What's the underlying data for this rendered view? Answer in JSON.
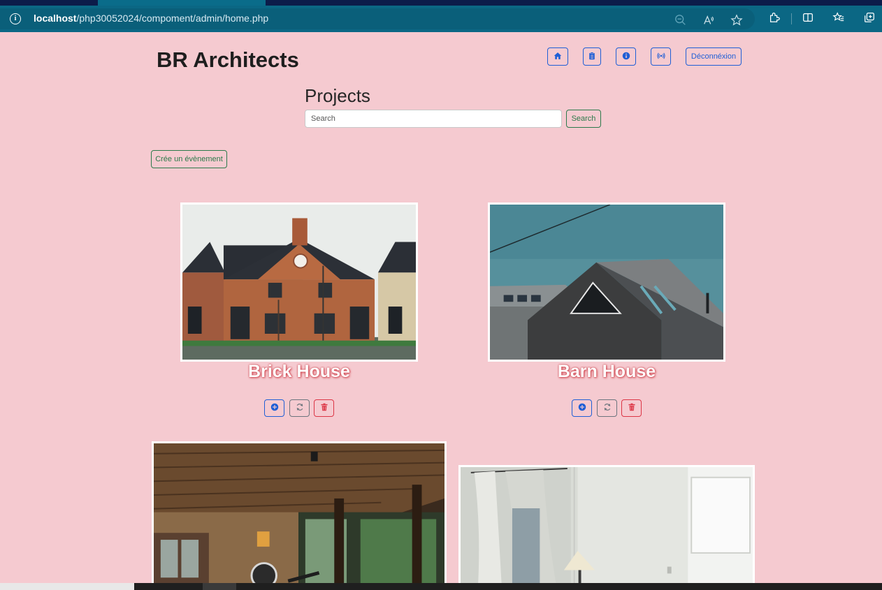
{
  "browser": {
    "url_host": "localhost",
    "url_path": "/php30052024/compoment/admin/home.php",
    "icons": [
      "info-icon",
      "zoom-out-icon",
      "read-aloud-icon",
      "favorite-star-icon",
      "extensions-icon",
      "split-screen-icon",
      "favorites-icon",
      "collections-icon"
    ]
  },
  "header": {
    "brand": "BR Architects",
    "nav": {
      "home_icon": "home-icon",
      "clipboard_icon": "clipboard-icon",
      "info_icon": "info-circle-icon",
      "broadcast_icon": "broadcast-icon",
      "logout_label": "Déconnéxion"
    }
  },
  "main": {
    "title": "Projects",
    "search": {
      "placeholder": "Search",
      "button_label": "Search"
    },
    "create_label": "Crée un évènement"
  },
  "projects": [
    {
      "title": "Brick House",
      "image": "brick-house-photo"
    },
    {
      "title": "Barn House",
      "image": "barn-house-photo"
    },
    {
      "title": "",
      "image": "wooden-porch-interior-photo"
    },
    {
      "title": "",
      "image": "white-room-curtains-photo"
    }
  ],
  "card_actions": {
    "view_icon": "plus-circle-icon",
    "edit_icon": "refresh-icon",
    "delete_icon": "trash-icon"
  },
  "colors": {
    "page_background": "#f5cad0",
    "primary": "#1f5fd6",
    "success": "#2c7a4b",
    "secondary": "#6c757d",
    "danger": "#dc3545",
    "browser_bar": "#0b6784"
  }
}
